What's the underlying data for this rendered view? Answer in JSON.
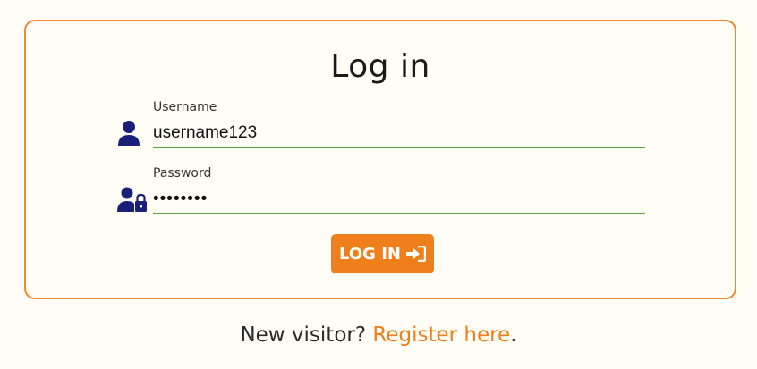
{
  "login_form": {
    "title": "Log in",
    "username": {
      "label": "Username",
      "value": "username123",
      "icon": "user-icon"
    },
    "password": {
      "label": "Password",
      "value": "password",
      "icon": "user-lock-icon"
    },
    "submit_label": "LOG IN",
    "submit_icon": "sign-in-icon"
  },
  "footer": {
    "prompt": "New visitor?",
    "register_link": "Register here",
    "suffix": "."
  },
  "colors": {
    "background": "#fffdf5",
    "accent": "#ee7f1a",
    "card_border": "#ee8a2e",
    "input_underline": "#5aa63a",
    "icon_color": "#1a1f7a"
  }
}
